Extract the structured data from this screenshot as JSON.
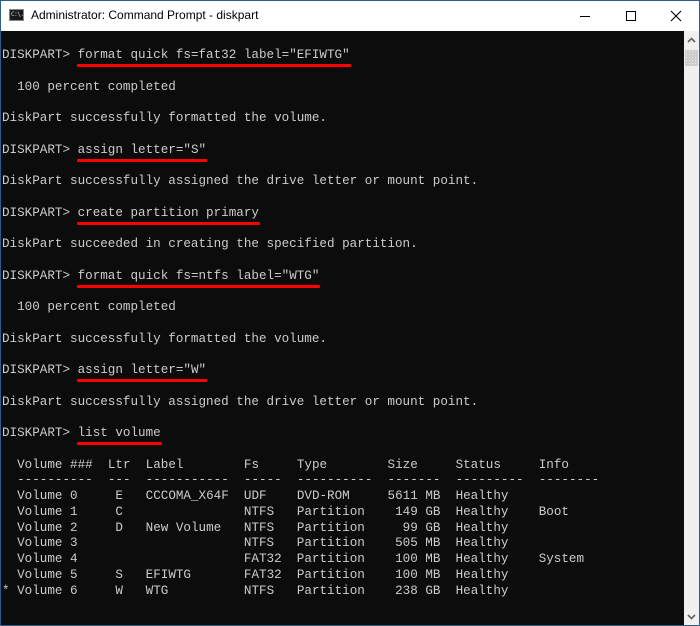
{
  "window": {
    "title": "Administrator: Command Prompt - diskpart",
    "icon": "cmd-icon",
    "icon_text": "C:\\.",
    "controls": {
      "minimize": "minimize-icon",
      "maximize": "maximize-icon",
      "close": "close-icon"
    }
  },
  "colors": {
    "terminal_bg": "#0c0c0c",
    "terminal_fg": "#cccccc",
    "highlight": "#ff0000"
  },
  "terminal": {
    "prompt": "DISKPART> ",
    "blocks": [
      {
        "command": "format quick fs=fat32 label=\"EFIWTG\"",
        "output": [
          "  100 percent completed",
          "DiskPart successfully formatted the volume."
        ]
      },
      {
        "command": "assign letter=\"S\"",
        "output": [
          "DiskPart successfully assigned the drive letter or mount point."
        ]
      },
      {
        "command": "create partition primary",
        "output": [
          "DiskPart succeeded in creating the specified partition."
        ]
      },
      {
        "command": "format quick fs=ntfs label=\"WTG\"",
        "output": [
          "  100 percent completed",
          "DiskPart successfully formatted the volume."
        ]
      },
      {
        "command": "assign letter=\"W\"",
        "output": [
          "DiskPart successfully assigned the drive letter or mount point."
        ]
      },
      {
        "command": "list volume",
        "output": []
      }
    ],
    "volume_table": {
      "headers": [
        "Volume ###",
        "Ltr",
        "Label",
        "Fs",
        "Type",
        "Size",
        "Status",
        "Info"
      ],
      "separators": [
        "----------",
        "---",
        "-----------",
        "-----",
        "----------",
        "-------",
        "---------",
        "--------"
      ],
      "rows": [
        {
          "marker": " ",
          "volume": "Volume 0",
          "ltr": "E",
          "label": "CCCOMA_X64F",
          "fs": "UDF",
          "type": "DVD-ROM",
          "size": "5611 MB",
          "status": "Healthy",
          "info": ""
        },
        {
          "marker": " ",
          "volume": "Volume 1",
          "ltr": "C",
          "label": "",
          "fs": "NTFS",
          "type": "Partition",
          "size": "149 GB",
          "status": "Healthy",
          "info": "Boot"
        },
        {
          "marker": " ",
          "volume": "Volume 2",
          "ltr": "D",
          "label": "New Volume",
          "fs": "NTFS",
          "type": "Partition",
          "size": "99 GB",
          "status": "Healthy",
          "info": ""
        },
        {
          "marker": " ",
          "volume": "Volume 3",
          "ltr": "",
          "label": "",
          "fs": "NTFS",
          "type": "Partition",
          "size": "505 MB",
          "status": "Healthy",
          "info": ""
        },
        {
          "marker": " ",
          "volume": "Volume 4",
          "ltr": "",
          "label": "",
          "fs": "FAT32",
          "type": "Partition",
          "size": "100 MB",
          "status": "Healthy",
          "info": "System"
        },
        {
          "marker": " ",
          "volume": "Volume 5",
          "ltr": "S",
          "label": "EFIWTG",
          "fs": "FAT32",
          "type": "Partition",
          "size": "100 MB",
          "status": "Healthy",
          "info": ""
        },
        {
          "marker": "*",
          "volume": "Volume 6",
          "ltr": "W",
          "label": "WTG",
          "fs": "NTFS",
          "type": "Partition",
          "size": "238 GB",
          "status": "Healthy",
          "info": ""
        }
      ]
    }
  },
  "scrollbar": {
    "up_icon": "chevron-up-icon",
    "down_icon": "chevron-down-icon"
  }
}
